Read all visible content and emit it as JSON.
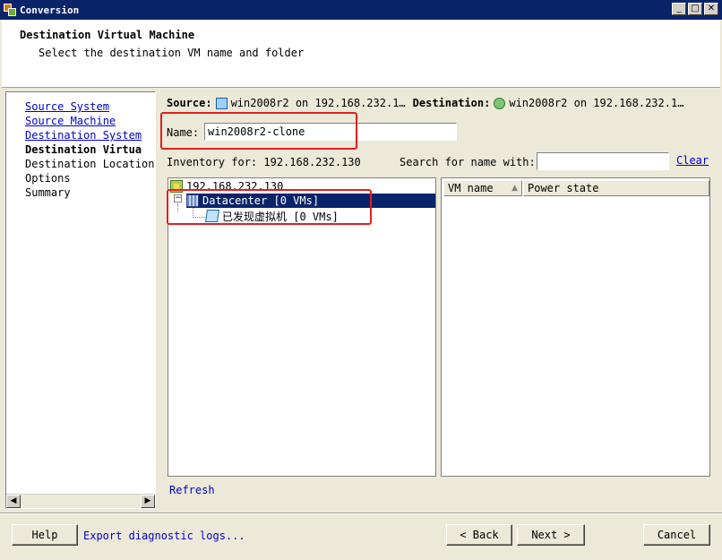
{
  "window": {
    "title": "Conversion"
  },
  "header": {
    "title": "Destination Virtual Machine",
    "subtitle": "Select the destination VM name and folder"
  },
  "sidebar": {
    "items": [
      {
        "label": "Source System",
        "state": "link"
      },
      {
        "label": "Source Machine",
        "state": "link"
      },
      {
        "label": "Destination System",
        "state": "link"
      },
      {
        "label": "Destination Virtua",
        "state": "current"
      },
      {
        "label": "Destination Location",
        "state": "plain"
      },
      {
        "label": "Options",
        "state": "plain"
      },
      {
        "label": "Summary",
        "state": "plain"
      }
    ]
  },
  "summary_bar": {
    "source_label": "Source:",
    "source_value": "win2008r2 on 192.168.232.1…",
    "destination_label": "Destination:",
    "destination_value": "win2008r2 on 192.168.232.1…"
  },
  "name_field": {
    "label": "Name:",
    "value": "win2008r2-clone"
  },
  "inventory": {
    "label": "Inventory for: 192.168.232.130"
  },
  "search": {
    "label": "Search for name with:",
    "value": "",
    "clear_label": "Clear"
  },
  "tree": {
    "host": "192.168.232.130",
    "datacenter": "Datacenter [0 VMs]",
    "folder": "已发现虚拟机 [0 VMs]"
  },
  "vm_table": {
    "columns": [
      "VM name",
      "Power state"
    ]
  },
  "refresh_label": "Refresh",
  "footer": {
    "help": "Help",
    "export": "Export diagnostic logs...",
    "back": "< Back",
    "next": "Next >",
    "cancel": "Cancel"
  },
  "colors": {
    "titlebar": "#0a246a",
    "selection": "#0a246a",
    "link": "#0000cc",
    "highlight": "#e02020"
  },
  "icons": [
    "app-icon",
    "source-vm-icon",
    "destination-host-icon",
    "host-icon",
    "datacenter-icon",
    "folder-icon",
    "minimize-icon",
    "maximize-icon",
    "close-icon"
  ]
}
